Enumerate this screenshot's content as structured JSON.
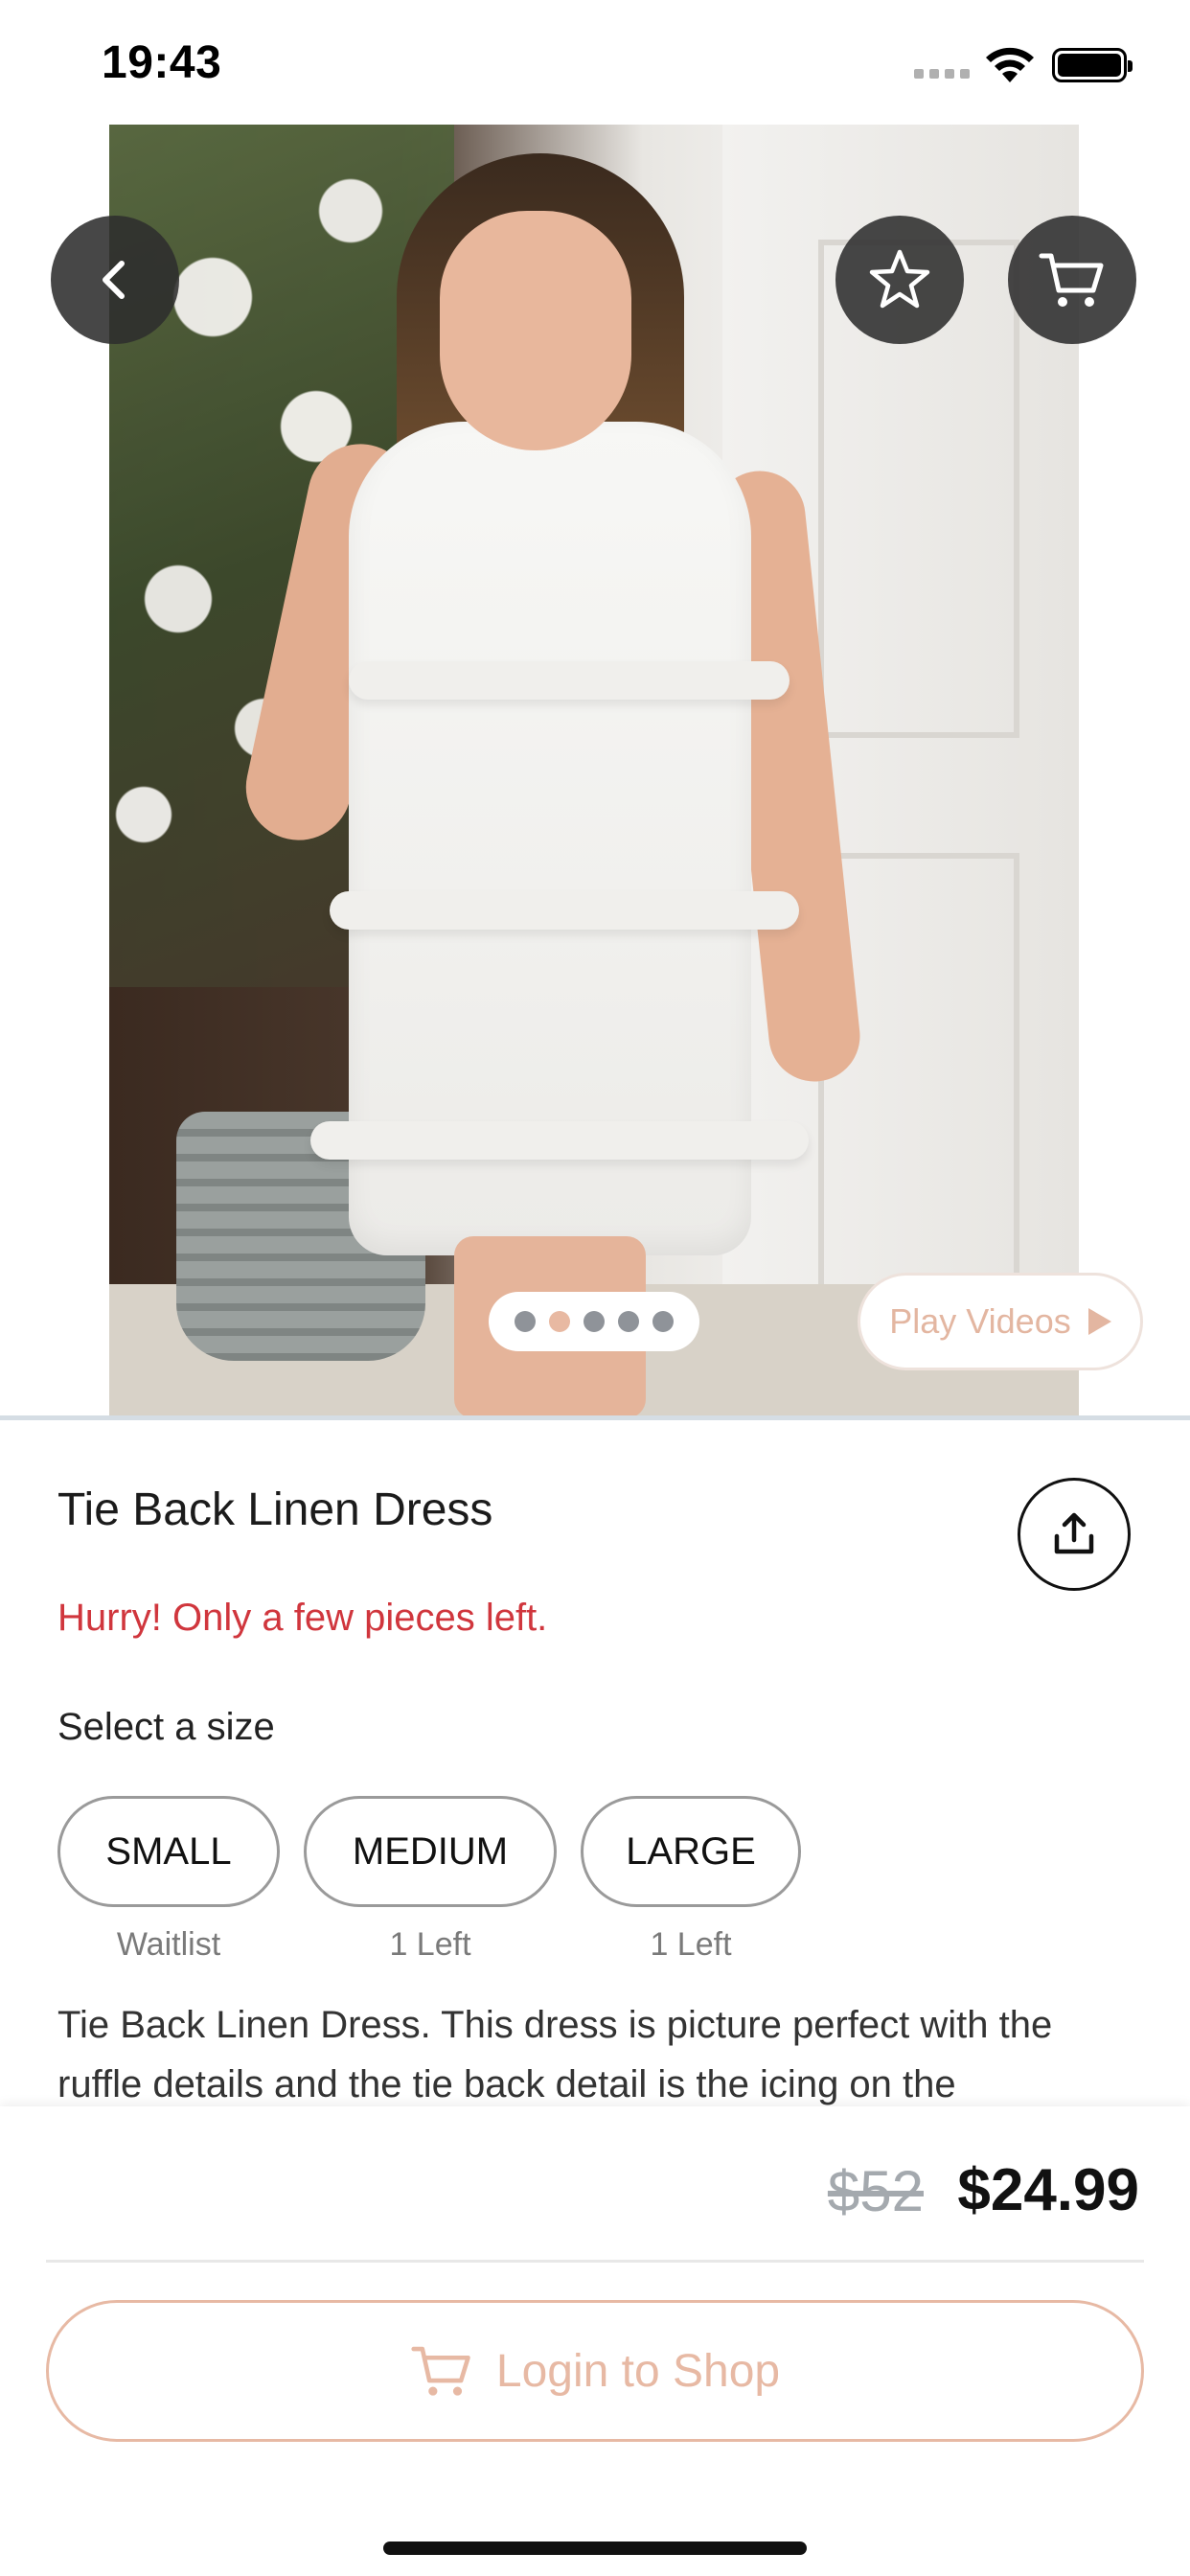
{
  "status_bar": {
    "time": "19:43"
  },
  "product": {
    "title": "Tie Back Linen Dress",
    "urgency": "Hurry! Only a few pieces left.",
    "size_prompt": "Select a size",
    "sizes": [
      {
        "label": "SMALL",
        "availability": "Waitlist"
      },
      {
        "label": "MEDIUM",
        "availability": "1 Left"
      },
      {
        "label": "LARGE",
        "availability": "1 Left"
      }
    ],
    "description": "Tie Back Linen Dress. This dress is picture perfect with the ruffle details and the tie back detail is the icing on the"
  },
  "gallery": {
    "image_count": 5,
    "active_index": 1,
    "play_videos_label": "Play Videos"
  },
  "pricing": {
    "original": "$52",
    "sale": "$24.99"
  },
  "actions": {
    "login_label": "Login to Shop"
  },
  "colors": {
    "accent": "#e7b9a4",
    "urgency": "#d0363d",
    "button_dark": "#2d2d2d"
  }
}
